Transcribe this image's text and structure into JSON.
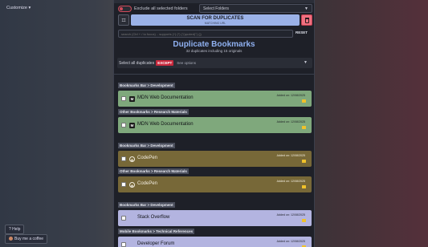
{
  "outside": {
    "customize_label": "Customize ▾",
    "help_label": "? Help",
    "coffee_label": "Buy me a coffee"
  },
  "controls": {
    "exclude_label": "Exclude all selected folders",
    "folders_select": "Select Folders",
    "scan_button": "SCAN FOR DUPLICATES",
    "scan_sub": "MATCHING URL",
    "search_placeholder": "search (Ctrl + / to focus) .. supports (^) (*) (\"(quoted)\") (|)",
    "reset_label": "RESET"
  },
  "summary": {
    "title": "Duplicate Bookmarks",
    "subtitle": "32 duplicates including 15 originals"
  },
  "except_row": {
    "label": "Select all duplicates",
    "badge": "EXCEPT",
    "options": "See options"
  },
  "paths": {
    "p1": "Bookmarks Bar > Development",
    "p2": "Other Bookmarks > Research Materials",
    "p3": "Bookmarks Bar > Development",
    "p4": "Other Bookmarks > Research Materials",
    "p5": "Bookmarks Bar > Development",
    "p6": "Mobile Bookmarks > Technical References"
  },
  "items": {
    "i1": {
      "name": "MDN Web Documentation",
      "date": "Added on: 12/08/2025",
      "favicon": "MDN"
    },
    "i2": {
      "name": "MDN Web Documentation",
      "date": "Added on: 12/08/2025",
      "favicon": "MDN"
    },
    "i3": {
      "name": "CodePen",
      "date": "Added on: 12/08/2025",
      "favicon": "codepen"
    },
    "i4": {
      "name": "CodePen",
      "date": "Added on: 12/08/2025",
      "favicon": "codepen"
    },
    "i5": {
      "name": "Stack Overflow",
      "date": "Added on: 12/08/2025",
      "favicon": "none"
    },
    "i6": {
      "name": "Developer Forum",
      "date": "Added on: 12/08/2025",
      "favicon": "none"
    }
  },
  "icons": {
    "toggle": "toggle-off-icon",
    "filter": "filter-icon",
    "trash": "trash-icon",
    "folder": "folder-icon",
    "favicon_mdn": "mdn-icon",
    "favicon_codepen": "codepen-icon"
  },
  "colors": {
    "scan_bg": "#9bb2e8",
    "trash_bg": "#f07080",
    "except_badge": "#c8283c",
    "green_group": "#7fa87c",
    "yellow_group": "#776838",
    "lavender_group": "#b3b4e0",
    "title": "#8fb0f0",
    "folder": "#f0c22a"
  }
}
